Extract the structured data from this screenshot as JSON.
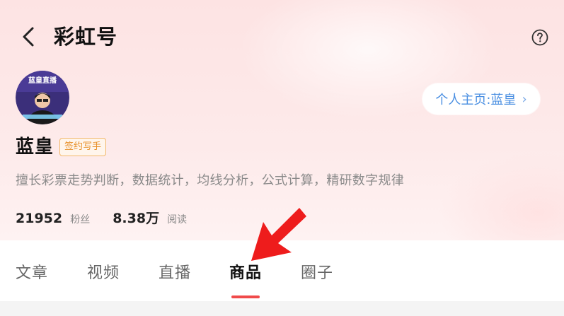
{
  "header": {
    "title": "彩虹号"
  },
  "profile": {
    "name": "蓝皇",
    "badge": "签约写手",
    "homepage_button": "个人主页:蓝皇",
    "bio": "擅长彩票走势判断，数据统计，均线分析，公式计算，精研数字规律",
    "stats": [
      {
        "value": "21952",
        "label": "粉丝"
      },
      {
        "value": "8.38万",
        "label": "阅读"
      }
    ],
    "avatar_text": "蓝皇直播"
  },
  "tabs": [
    {
      "label": "文章",
      "active": false
    },
    {
      "label": "视频",
      "active": false
    },
    {
      "label": "直播",
      "active": false
    },
    {
      "label": "商品",
      "active": true
    },
    {
      "label": "圈子",
      "active": false
    }
  ],
  "colors": {
    "accent": "#f04a4a",
    "link": "#4a8fe2",
    "badge": "#e8912b",
    "hero_bg": "#fde3e3"
  },
  "icons": {
    "back": "chevron-left-icon",
    "help": "question-circle-icon",
    "annotation": "red-arrow-pointer"
  }
}
